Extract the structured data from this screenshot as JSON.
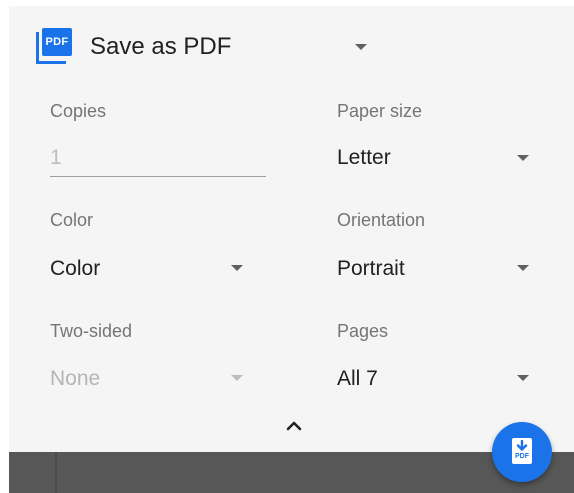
{
  "destination": {
    "icon": "pdf-icon",
    "icon_text": "PDF",
    "name": "Save as PDF"
  },
  "copies": {
    "label": "Copies",
    "placeholder": "1"
  },
  "paper_size": {
    "label": "Paper size",
    "value": "Letter"
  },
  "color": {
    "label": "Color",
    "value": "Color"
  },
  "orientation": {
    "label": "Orientation",
    "value": "Portrait"
  },
  "two_sided": {
    "label": "Two-sided",
    "value": "None"
  },
  "pages": {
    "label": "Pages",
    "value": "All 7"
  },
  "fab": {
    "icon": "save-pdf-icon",
    "icon_text": "PDF"
  },
  "colors": {
    "accent": "#1a73e8",
    "panel": "#f5f5f5"
  }
}
